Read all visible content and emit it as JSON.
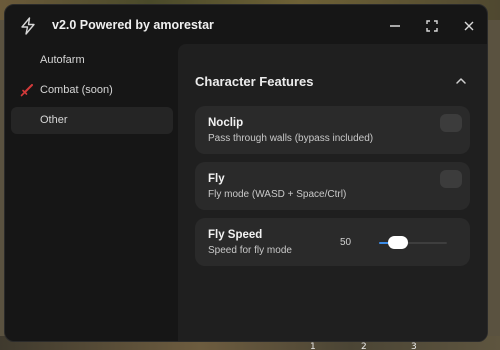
{
  "window": {
    "title": "v2.0 Powered by amorestar"
  },
  "sidebar": {
    "items": [
      {
        "label": "Autofarm",
        "icon": "none",
        "active": false
      },
      {
        "label": "Combat (soon)",
        "icon": "sword-icon",
        "active": false
      },
      {
        "label": "Other",
        "icon": "none",
        "active": true
      }
    ]
  },
  "section": {
    "title": "Character Features"
  },
  "features": {
    "noclip": {
      "title": "Noclip",
      "description": "Pass through walls (bypass included)",
      "enabled": false
    },
    "fly": {
      "title": "Fly",
      "description": "Fly mode (WASD + Space/Ctrl)",
      "enabled": false
    },
    "fly_speed": {
      "title": "Fly Speed",
      "description": "Speed for fly mode",
      "value": "50",
      "fill_percent": 28
    }
  },
  "background": {
    "hotbar_numbers": [
      "1",
      "2",
      "3"
    ]
  },
  "colors": {
    "accent": "#3c8ce7",
    "sword": "#d23a3a",
    "window_bg": "#161616",
    "panel_bg": "#1f1f1f",
    "card_bg": "#2a2a2a"
  }
}
